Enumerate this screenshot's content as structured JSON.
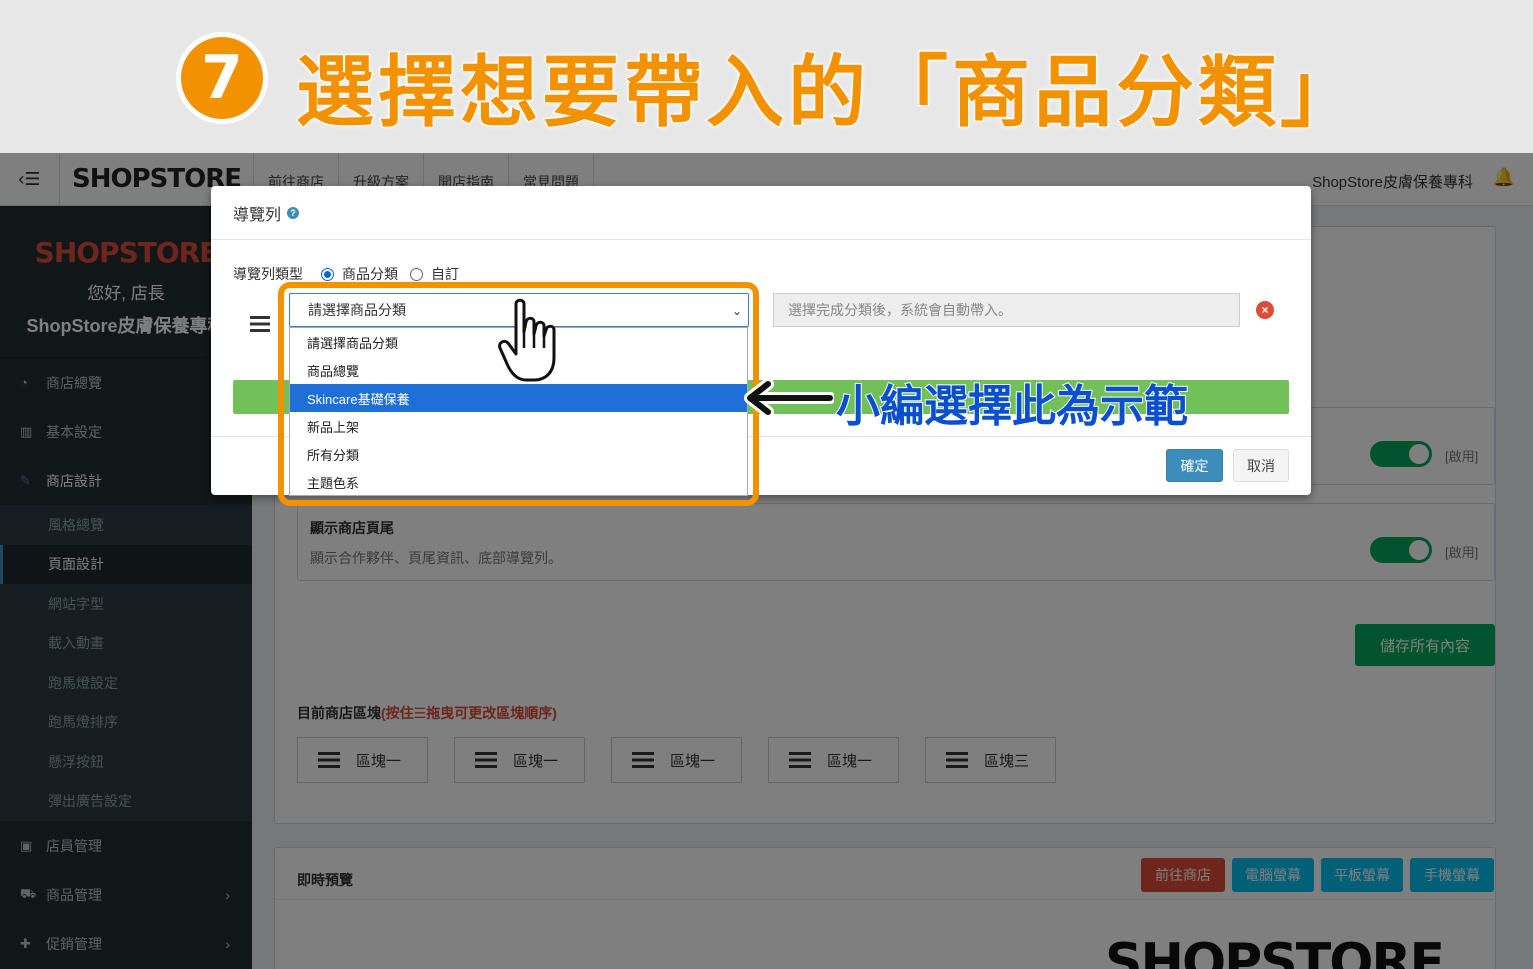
{
  "banner": {
    "step": "7",
    "title": "選擇想要帶入的「商品分類」"
  },
  "topbar": {
    "logo": "SHOPSTORE",
    "nav": [
      "前往商店",
      "升級方案",
      "開店指南",
      "常見問題"
    ],
    "store_name": "ShopStore皮膚保養專科"
  },
  "sidebar": {
    "brand_logo": "SHOPSTORE",
    "greeting": "您好, 店長",
    "store_name": "ShopStore皮膚保養專科",
    "items": [
      {
        "label": "商店總覽",
        "icon": "dashboard-icon"
      },
      {
        "label": "基本設定",
        "icon": "bank-icon"
      },
      {
        "label": "商店設計",
        "icon": "brush-icon"
      }
    ],
    "sub_items": [
      "風格總覽",
      "頁面設計",
      "網站字型",
      "載入動畫",
      "跑馬燈設定",
      "跑馬燈排序",
      "懸浮按鈕",
      "彈出廣告設定"
    ],
    "bottom_items": [
      {
        "label": "店員管理",
        "icon": "lock-icon"
      },
      {
        "label": "商品管理",
        "icon": "cart-icon"
      },
      {
        "label": "促銷管理",
        "icon": "gift-icon"
      }
    ]
  },
  "content": {
    "toggle_label": "[啟用]",
    "footer_panel_title": "顯示商店頁尾",
    "footer_panel_desc": "顯示合作夥伴、頁尾資訊、底部導覽列。",
    "save_all": "儲存所有內容",
    "blocks_title": "目前商店區塊",
    "blocks_hint": "(按住☰拖曳可更改區塊順序)",
    "blocks": [
      "區塊一",
      "區塊一",
      "區塊一",
      "區塊一",
      "區塊三"
    ],
    "preview_title": "即時預覽",
    "preview_buttons": [
      "前往商店",
      "電腦螢幕",
      "平板螢幕",
      "手機螢幕"
    ],
    "preview_logo": "SHOPSTORE"
  },
  "modal": {
    "title": "導覽列",
    "type_label": "導覽列類型",
    "type_options": [
      "商品分類",
      "自訂"
    ],
    "selected_type": "商品分類",
    "select_value": "請選擇商品分類",
    "auto_placeholder": "選擇完成分類後，系統會自動帶入。",
    "ok": "確定",
    "cancel": "取消",
    "options": [
      "請選擇商品分類",
      "商品總覽",
      "Skincare基礎保養",
      "新品上架",
      "所有分類",
      "主題色系"
    ],
    "highlighted_option": "Skincare基礎保養"
  },
  "annotation": {
    "note": "小編選擇此為示範",
    "highlight_color": "#f39200",
    "note_color": "#0a4fd0"
  }
}
